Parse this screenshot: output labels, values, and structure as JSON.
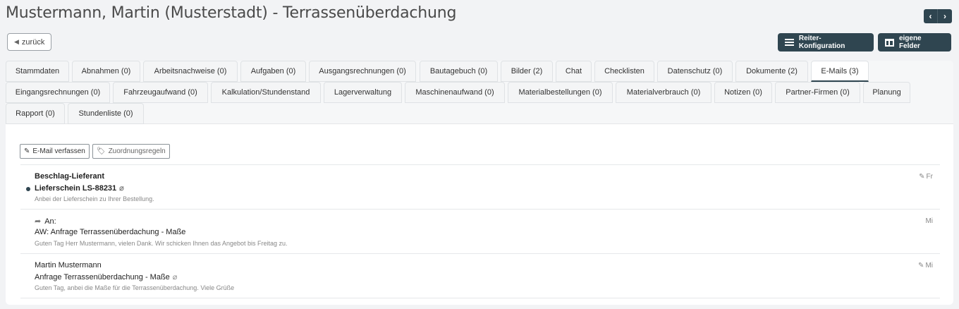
{
  "page": {
    "title": "Mustermann, Martin (Musterstadt) - Terrassenüberdachung"
  },
  "nav": {
    "prev": "‹",
    "next": "›",
    "back_label": "zurück"
  },
  "actions": {
    "reiter_label": "Reiter-Konfiguration",
    "felder_label": "eigene Felder"
  },
  "tabs": [
    "Stammdaten",
    "Abnahmen (0)",
    "Arbeitsnachweise (0)",
    "Aufgaben (0)",
    "Ausgangsrechnungen (0)",
    "Bautagebuch (0)",
    "Bilder (2)",
    "Chat",
    "Checklisten",
    "Datenschutz (0)",
    "Dokumente (2)",
    "E-Mails (3)",
    "Eingangsrechnungen (0)",
    "Fahrzeugaufwand (0)",
    "Kalkulation/Stundenstand",
    "Lagerverwaltung",
    "Maschinenaufwand (0)",
    "Materialbestellungen (0)",
    "Materialverbrauch (0)",
    "Notizen (0)",
    "Partner-Firmen (0)",
    "Planung",
    "Rapport (0)",
    "Stundenliste (0)"
  ],
  "active_tab": "E-Mails (3)",
  "toolbar": {
    "compose_label": "E-Mail verfassen",
    "rules_label": "Zuordnungsregeln"
  },
  "emails": [
    {
      "from": "Beschlag-Lieferant",
      "subject": "Lieferschein LS-88231",
      "preview": "Anbei der Lieferschein zu Ihrer Bestellung.",
      "day": "Fr"
    },
    {
      "from": "An:",
      "subject": "AW: Anfrage Terrassenüberdachung - Maße",
      "preview": "Guten Tag Herr Mustermann, vielen Dank. Wir schicken Ihnen das Angebot bis Freitag zu.",
      "day": "Mi"
    },
    {
      "from": "Martin Mustermann",
      "subject": "Anfrage Terrassenüberdachung - Maße",
      "preview": "Guten Tag, anbei die Maße für die Terrassenüberdachung. Viele Grüße",
      "day": "Mi"
    }
  ]
}
